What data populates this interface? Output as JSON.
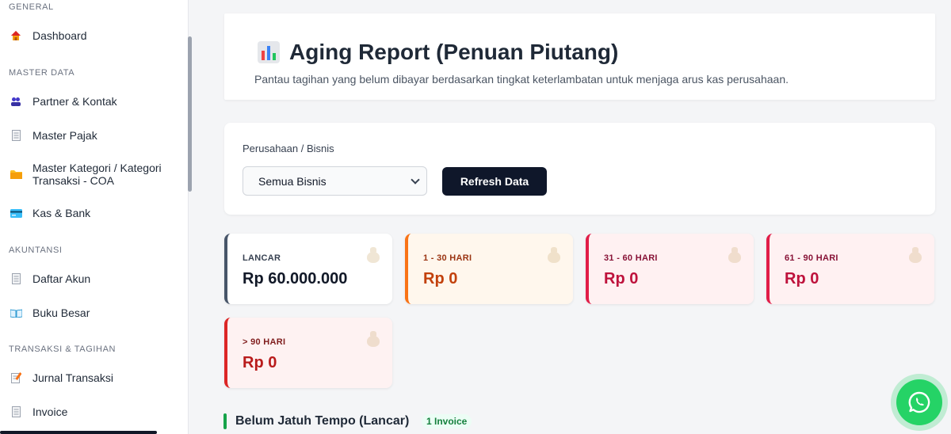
{
  "sidebar": {
    "sections": {
      "general": "GENERAL",
      "master_data": "MASTER DATA",
      "akuntansi": "AKUNTANSI",
      "transaksi": "TRANSAKSI & TAGIHAN"
    },
    "items": {
      "dashboard": "Dashboard",
      "partner": "Partner & Kontak",
      "pajak": "Master Pajak",
      "kategori": "Master Kategori / Kategori Transaksi - COA",
      "kas": "Kas & Bank",
      "daftar_akun": "Daftar Akun",
      "buku_besar": "Buku Besar",
      "jurnal": "Jurnal Transaksi",
      "invoice": "Invoice"
    },
    "icons": {
      "dashboard": "house-icon",
      "partner": "people-icon",
      "pajak": "document-icon",
      "kategori": "folder-icon",
      "kas": "card-icon",
      "daftar_akun": "document-icon",
      "buku_besar": "book-icon",
      "jurnal": "memo-icon",
      "invoice": "document-icon"
    }
  },
  "header": {
    "title": "Aging Report (Penuan Piutang)",
    "subtitle": "Pantau tagihan yang belum dibayar berdasarkan tingkat keterlambatan untuk menjaga arus kas perusahaan."
  },
  "filter": {
    "label": "Perusahaan / Bisnis",
    "selected": "Semua Bisnis",
    "refresh_label": "Refresh Data"
  },
  "stats": [
    {
      "label": "LANCAR",
      "value": "Rp 60.000.000",
      "accent": "#475569",
      "bg": "#ffffff",
      "text": "#111827",
      "labelColor": "#374151"
    },
    {
      "label": "1 - 30 HARI",
      "value": "Rp 0",
      "accent": "#f97316",
      "bg": "#fff7ed",
      "text": "#c2410c",
      "labelColor": "#9a3412"
    },
    {
      "label": "31 - 60 HARI",
      "value": "Rp 0",
      "accent": "#e11d48",
      "bg": "#fff1f2",
      "text": "#be123c",
      "labelColor": "#881337"
    },
    {
      "label": "61 - 90 HARI",
      "value": "Rp 0",
      "accent": "#e11d48",
      "bg": "#fff1f2",
      "text": "#be123c",
      "labelColor": "#881337"
    },
    {
      "label": "> 90 HARI",
      "value": "Rp 0",
      "accent": "#dc2626",
      "bg": "#fef2f2",
      "text": "#b91c1c",
      "labelColor": "#7f1d1d"
    }
  ],
  "section": {
    "title": "Belum Jatuh Tempo (Lancar)",
    "badge": "1 Invoice"
  },
  "colors": {
    "primary_button": "#0f172a",
    "whatsapp": "#25d366",
    "success": "#16a34a"
  }
}
